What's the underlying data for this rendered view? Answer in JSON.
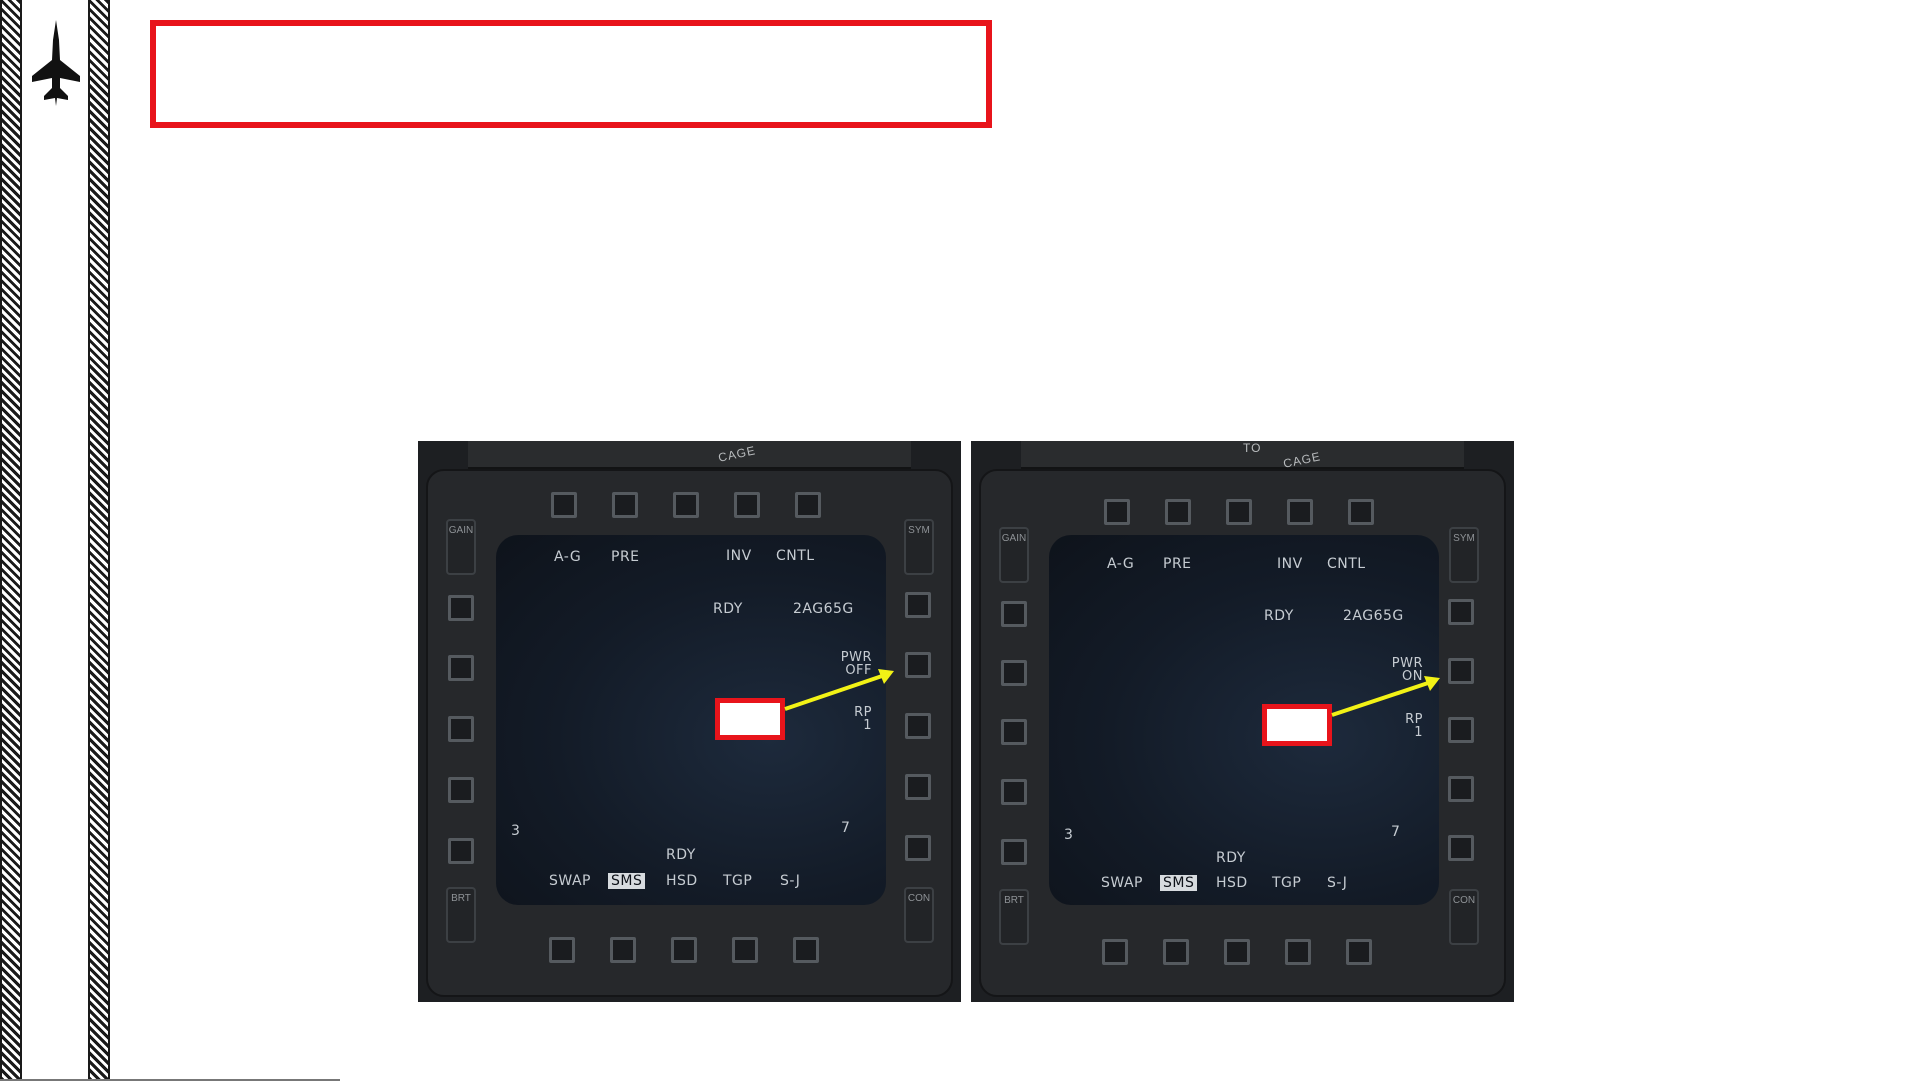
{
  "colors": {
    "highlight_red": "#e8141b",
    "arrow_yellow": "#f2f216",
    "mfd_text": "#c6ccd2"
  },
  "icons": {
    "logo": "fighter-jet-icon"
  },
  "title_box": {
    "text": ""
  },
  "panels": [
    {
      "cage_label": "CAGE",
      "rocker_top_left": "GAIN",
      "rocker_top_right": "SYM",
      "rocker_bottom_left": "BRT",
      "rocker_bottom_right": "CON",
      "top_labels": [
        "A-G",
        "PRE",
        "INV",
        "CNTL"
      ],
      "rdy_top": "RDY",
      "weapon": "2AG65G",
      "pwr_line1": "PWR",
      "pwr_line2": "OFF",
      "rp_line1": "RP",
      "rp_line2": "1",
      "left_num": "3",
      "right_num": "7",
      "rdy_bottom": "RDY",
      "bottom_labels": [
        "SWAP",
        "SMS",
        "HSD",
        "TGP",
        "S-J"
      ]
    },
    {
      "cage_label": "CAGE",
      "cage_top": "TO",
      "rocker_top_left": "GAIN",
      "rocker_top_right": "SYM",
      "rocker_bottom_left": "BRT",
      "rocker_bottom_right": "CON",
      "top_labels": [
        "A-G",
        "PRE",
        "INV",
        "CNTL"
      ],
      "rdy_top": "RDY",
      "weapon": "2AG65G",
      "pwr_line1": "PWR",
      "pwr_line2": "ON",
      "rp_line1": "RP",
      "rp_line2": "1",
      "left_num": "3",
      "right_num": "7",
      "rdy_bottom": "RDY",
      "bottom_labels": [
        "SWAP",
        "SMS",
        "HSD",
        "TGP",
        "S-J"
      ]
    }
  ]
}
